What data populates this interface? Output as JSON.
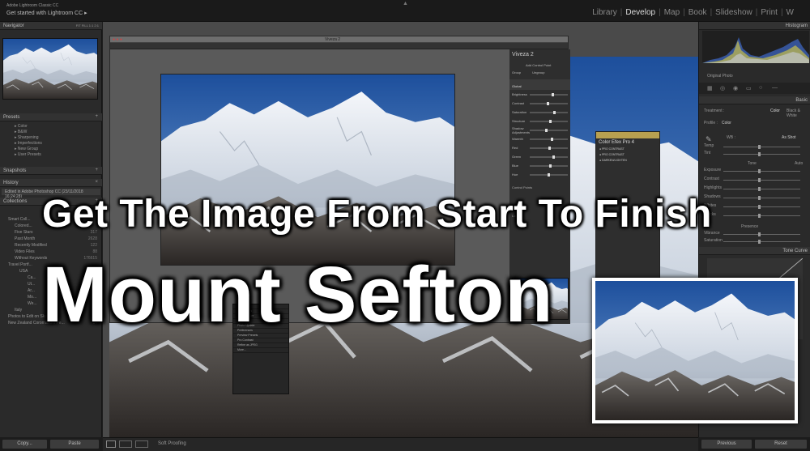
{
  "app": {
    "brand_line1": "Adobe Lightroom Classic CC",
    "brand_line2": "Get started with Lightroom CC ▸"
  },
  "modules": [
    "Library",
    "Develop",
    "Map",
    "Book",
    "Slideshow",
    "Print",
    "W"
  ],
  "active_module": "Develop",
  "left_panel": {
    "navigator": {
      "title": "Navigator",
      "zoom": [
        "FIT",
        "FILL",
        "1:1",
        "2:1"
      ]
    },
    "presets": {
      "title": "Presets",
      "items": [
        "Color",
        "B&W",
        "Sharpening",
        "Imperfections",
        "New Group",
        "User Presets"
      ]
    },
    "snapshots": {
      "title": "Snapshots"
    },
    "history": {
      "title": "History",
      "items": [
        "Edited in Adobe Photoshop CC (23/11/2018 16:24:28)"
      ]
    },
    "collections": {
      "title": "Collections",
      "items": [
        {
          "name": "Smart Coll...",
          "count": ""
        },
        {
          "name": "Colored...",
          "count": ""
        },
        {
          "name": "Five Stars",
          "count": "317"
        },
        {
          "name": "Past Month",
          "count": "2628"
        },
        {
          "name": "Recently Modified",
          "count": "122"
        },
        {
          "name": "Video Files",
          "count": "88"
        },
        {
          "name": "Without Keywords",
          "count": "176615"
        },
        {
          "name": "Travel Portf...",
          "count": ""
        },
        {
          "name": "USA",
          "count": ""
        },
        {
          "name": "Ca...",
          "count": ""
        },
        {
          "name": "Ut...",
          "count": ""
        },
        {
          "name": "Ar...",
          "count": ""
        },
        {
          "name": "Mo...",
          "count": ""
        },
        {
          "name": "We...",
          "count": ""
        },
        {
          "name": "Italy",
          "count": ""
        },
        {
          "name": "Photos to Edit on Skaut",
          "count": ""
        },
        {
          "name": "New Zealand Coromandel Pe...",
          "count": "14"
        }
      ]
    },
    "copy_label": "Copy...",
    "paste_label": "Paste"
  },
  "filmstrip": {
    "soft_proofing": "Soft Proofing"
  },
  "right_panel": {
    "histogram_title": "Histogram",
    "original_photo": "Original Photo",
    "basic_title": "Basic",
    "treatment_label": "Treatment :",
    "treatment_color": "Color",
    "treatment_bw": "Black & White",
    "profile_label": "Profile :",
    "profile_value": "Color",
    "wb_label": "WB :",
    "wb_value": "As Shot",
    "sliders_wb": [
      "Temp",
      "Tint"
    ],
    "tone_label": "Tone",
    "tone_auto": "Auto",
    "sliders_tone": [
      "Exposure",
      "Contrast",
      "Highlights",
      "Shadows",
      "Whites",
      "Blacks"
    ],
    "presence_label": "Presence",
    "sliders_presence": [
      "Vibrance",
      "Saturation"
    ],
    "tone_curve_title": "Tone Curve",
    "previous_label": "Previous",
    "reset_label": "Reset"
  },
  "viveza": {
    "window_title": "Viveza 2",
    "panel_title": "Viveza 2",
    "add_control_point": "Add Control Point",
    "group": "Group",
    "ungroup": "Ungroup",
    "global": "Global",
    "sliders": [
      "Brightness",
      "Contrast",
      "Saturation",
      "Structure",
      "Shadow Adjustments",
      "Warmth",
      "Red",
      "Green",
      "Blue",
      "Hue"
    ],
    "control_points": "Control Points",
    "loupe": "Loupe"
  },
  "color_efex": {
    "title": "Color Efex Pro 4",
    "items": [
      "PRO CONTRAST",
      "PRO CONTRAST",
      "DARKEN/LIGHTEN"
    ]
  },
  "small_window_items": [
    "Kit Finder",
    "List Folders",
    "Paper Finder",
    "Scripts",
    "Photo Update",
    "Preferences",
    "Preview Presets",
    "Pro Contrast",
    "Refine as JPEG",
    "More..."
  ],
  "overlay": {
    "headline": "Get The Image From Start To Finish",
    "title": "Mount Sefton"
  }
}
